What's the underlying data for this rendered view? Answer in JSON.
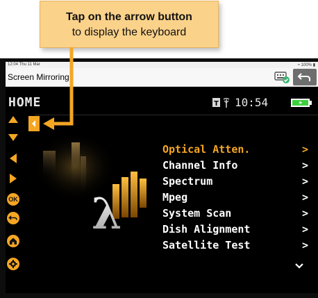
{
  "callout": {
    "line1": "Tap on the arrow button",
    "line2": "to display the keyboard"
  },
  "status_bar": {
    "time": "12:04  Thu 11 Mar",
    "battery": "100%"
  },
  "nav": {
    "title": "Screen Mirroring"
  },
  "screen": {
    "title": "HOME",
    "clock": "10:54",
    "menu": [
      {
        "label": "Optical Atten.",
        "arrow": ">",
        "active": true
      },
      {
        "label": "Channel Info",
        "arrow": ">"
      },
      {
        "label": "Spectrum",
        "arrow": ">"
      },
      {
        "label": "Mpeg",
        "arrow": ">"
      },
      {
        "label": "System Scan",
        "arrow": ">"
      },
      {
        "label": "Dish Alignment",
        "arrow": ">"
      },
      {
        "label": "Satellite Test",
        "arrow": ">"
      }
    ],
    "toolbar": {
      "ok_label": "OK",
      "icons": [
        "up-arrow-icon",
        "down-arrow-icon",
        "left-arrow-icon",
        "right-arrow-icon",
        "ok-icon",
        "back-icon",
        "home-icon",
        "settings-icon"
      ]
    }
  },
  "colors": {
    "accent": "#f5a623",
    "callout_bg": "#fbd28a",
    "screen_bg": "#000000",
    "menu_text": "#ffffff",
    "battery_fill": "#3ad13a"
  }
}
